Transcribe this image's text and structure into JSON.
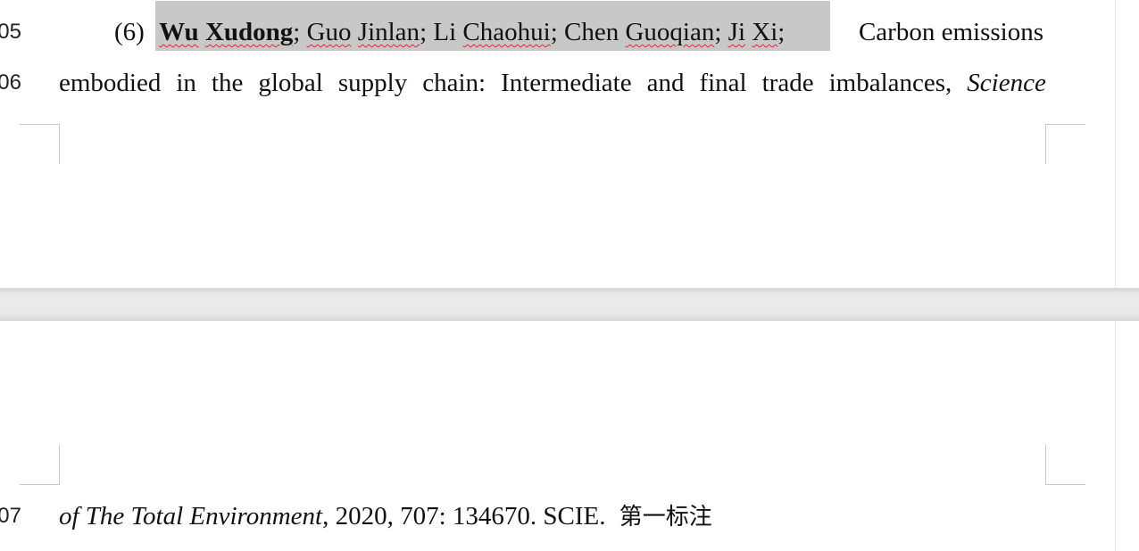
{
  "document": {
    "line_numbers": [
      "05",
      "06",
      "07"
    ],
    "entry": {
      "number": "(6)",
      "authors": {
        "bold_author": {
          "given": "Wu",
          "family": "Xudong"
        },
        "others": [
          {
            "given": "Guo",
            "family": "Jinlan"
          },
          {
            "given": "Li",
            "family": "Chaohui"
          },
          {
            "given": "Chen",
            "family": "Guoqian"
          },
          {
            "given": "Ji",
            "family": "Xi"
          }
        ],
        "separator": ";"
      },
      "title_line1_rest": "Carbon emissions",
      "title_line2_words": [
        "embodied",
        "in",
        "the",
        "global",
        "supply",
        "chain:",
        "Intermediate",
        "and",
        "final",
        "trade",
        "imbalances,"
      ],
      "journal_line2": "Science",
      "journal_line3": "of The Total Environment",
      "citation_rest": ", 2020, 707: 134670. SCIE.",
      "note": "第一标注"
    }
  },
  "colors": {
    "selection": "#c8c8c8",
    "spell_squiggle": "#d03030",
    "page_gap": "#e8e8e8"
  }
}
